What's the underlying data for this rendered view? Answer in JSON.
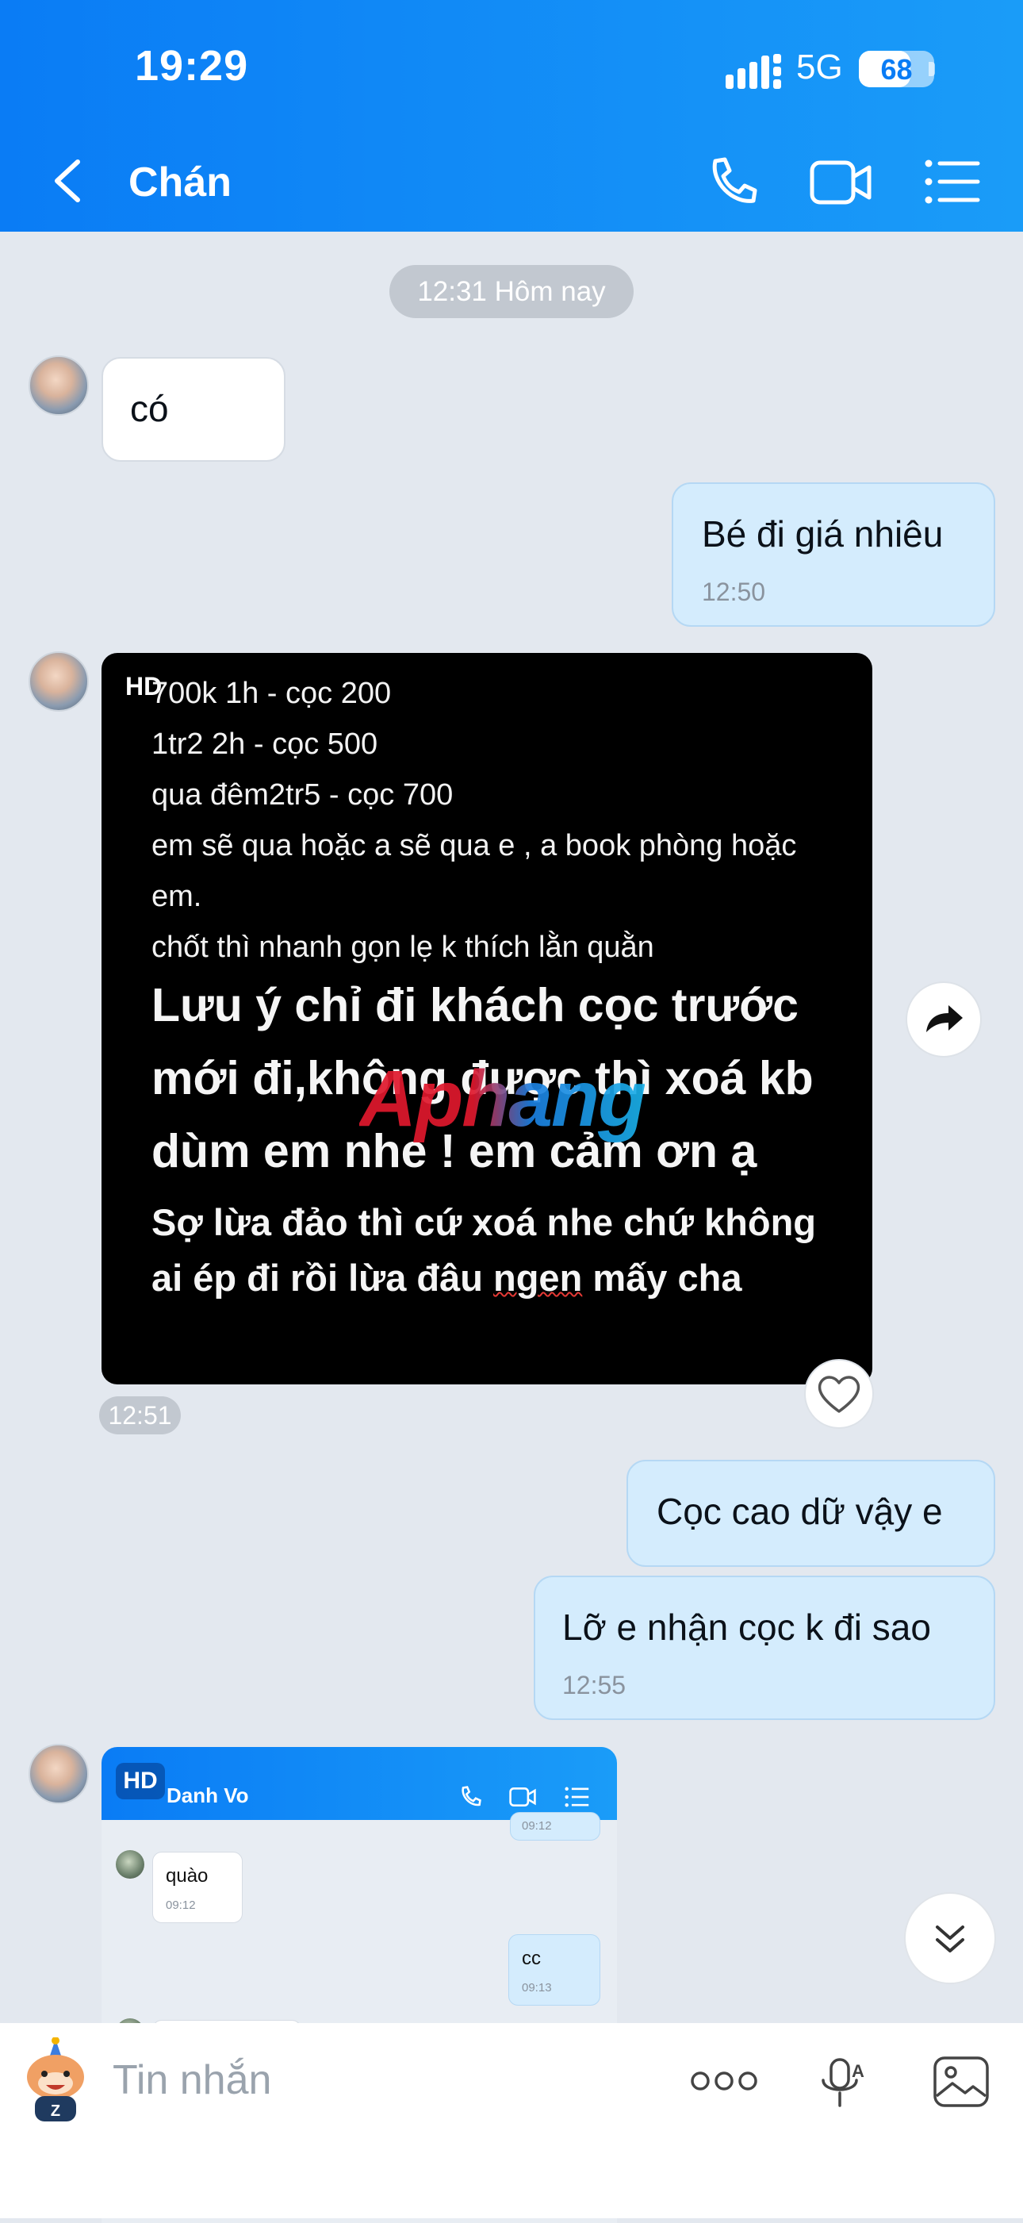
{
  "status_bar": {
    "time": "19:29",
    "network": "5G",
    "battery": "68",
    "battery_level": 0.68
  },
  "header": {
    "title": "Chán"
  },
  "timeline": {
    "date_pill": "12:31 Hôm nay"
  },
  "messages": {
    "m1": {
      "text": "có"
    },
    "m2": {
      "text": "Bé đi giá nhiêu",
      "time": "12:50"
    },
    "post": {
      "badge": "HD",
      "lines": [
        "700k 1h - cọc 200",
        "1tr2 2h - cọc 500",
        "qua đêm2tr5 - cọc 700",
        "em sẽ qua hoặc a sẽ qua e , a book phòng hoặc",
        "em.",
        "chốt thì nhanh gọn lẹ k thích lằn quằn"
      ],
      "big_lines": [
        "Lưu ý chỉ đi khách cọc trước",
        "mới đi,không được thì xoá kb",
        "dùm em nhe ! em cảm ơn ạ"
      ],
      "mid_line_1": "Sợ lừa đảo thì cứ xoá nhe chứ không",
      "mid_line_2_a": "ai ép đi rồi lừa đâu ",
      "mid_line_2_b": "ngen",
      "mid_line_2_c": " mấy cha",
      "watermark": "Aphang",
      "time": "12:51"
    },
    "m3": {
      "text": "Cọc cao dữ vậy e"
    },
    "m4": {
      "text": "Lỡ e nhận cọc k đi sao",
      "time": "12:55"
    },
    "screenshot": {
      "badge": "HD",
      "title": "Danh Vo",
      "top_time": "09:12",
      "msg1": {
        "text": "quào",
        "time": "09:12"
      },
      "msg2": {
        "text": "cc",
        "time": "09:13"
      }
    }
  },
  "composer": {
    "placeholder": "Tin nhắn"
  },
  "icons": {
    "back": "chevron-left-icon",
    "call": "phone-icon",
    "video": "video-camera-icon",
    "menu": "list-menu-icon",
    "share": "share-arrow-icon",
    "heart": "heart-icon",
    "scroll": "double-chevron-down-icon",
    "sticker": "sticker-icon",
    "more": "more-dots-icon",
    "voice": "microphone-icon",
    "image": "image-icon"
  },
  "colors": {
    "header": "#0a7cf5",
    "bubble_out": "#d4ecfd",
    "background": "#e3e8ef"
  }
}
